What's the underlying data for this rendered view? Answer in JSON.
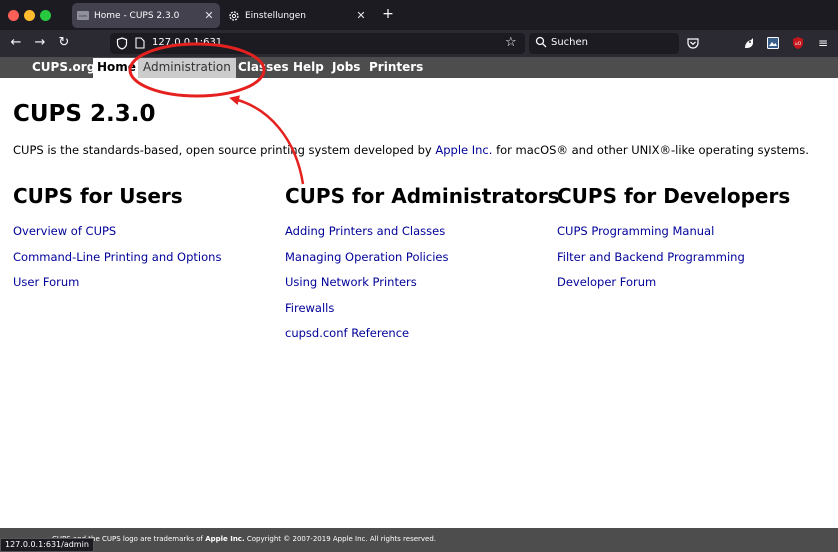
{
  "browser": {
    "tabs": [
      {
        "title": "Home - CUPS 2.3.0",
        "active": true,
        "favicon": "CUPS"
      },
      {
        "title": "Einstellungen",
        "active": false
      }
    ],
    "url": "127.0.0.1:631",
    "search_placeholder": "Suchen",
    "status_url": "127.0.0.1:631/admin"
  },
  "cups_nav": {
    "items": [
      "CUPS.org",
      "Home",
      "Administration",
      "Classes",
      "Help",
      "Jobs",
      "Printers"
    ]
  },
  "page": {
    "title": "CUPS 2.3.0",
    "intro_before": "CUPS is the standards-based, open source printing system developed by ",
    "intro_link": "Apple Inc.",
    "intro_after": " for macOS® and other UNIX®-like operating systems."
  },
  "columns": [
    {
      "heading": "CUPS for Users",
      "links": [
        "Overview of CUPS",
        "Command-Line Printing and Options",
        "User Forum"
      ]
    },
    {
      "heading": "CUPS for Administrators",
      "links": [
        "Adding Printers and Classes",
        "Managing Operation Policies",
        "Using Network Printers",
        "Firewalls",
        "cupsd.conf Reference"
      ]
    },
    {
      "heading": "CUPS for Developers",
      "links": [
        "CUPS Programming Manual",
        "Filter and Backend Programming",
        "Developer Forum"
      ]
    }
  ],
  "footer": {
    "prefix": "CUPS and the CUPS logo are trademarks of ",
    "brand": "Apple Inc.",
    "suffix": " Copyright © 2007-2019 Apple Inc. All rights reserved."
  },
  "colors": {
    "link": "#000099",
    "annotation": "#e5211f",
    "header_bg": "#4d4d4d",
    "chrome_bg": "#1c1b22"
  }
}
